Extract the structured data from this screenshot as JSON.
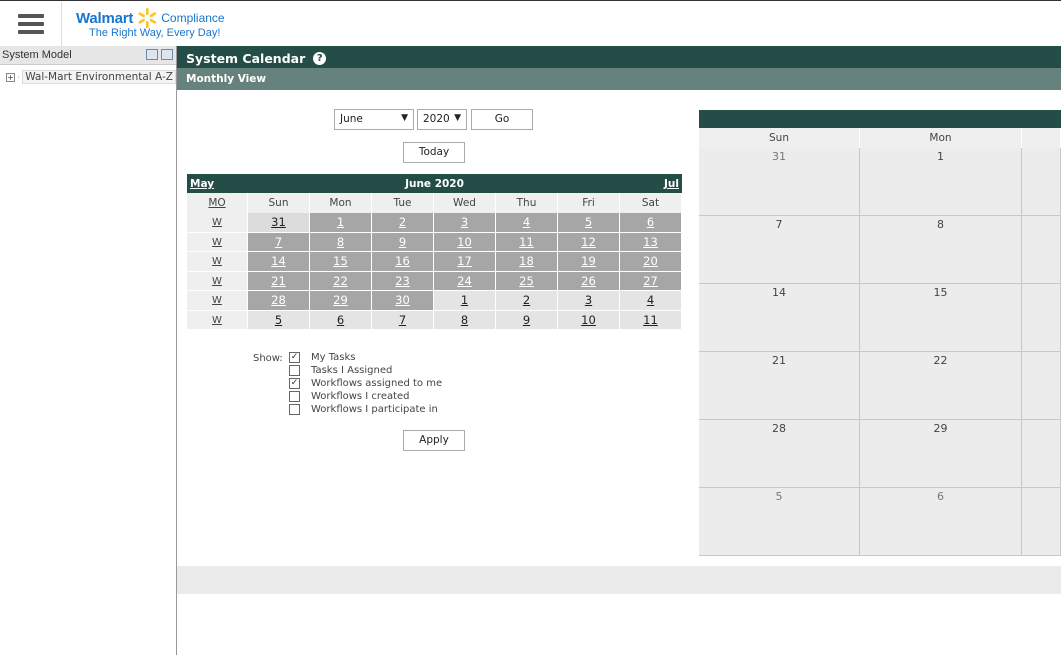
{
  "header": {
    "brand": "Walmart",
    "brand_suffix": "Compliance",
    "tagline": "The Right Way, Every Day!",
    "brand_color": "#1a75cf",
    "spark_color": "#ffc220"
  },
  "sidebar": {
    "title": "System Model",
    "tree": [
      {
        "expander": "+",
        "icon": "home-icon",
        "label": "Wal-Mart Environmental A-Z"
      }
    ]
  },
  "main": {
    "title": "System Calendar",
    "subtitle": "Monthly View",
    "controls": {
      "month": "June",
      "year": "2020",
      "go_label": "Go",
      "today_label": "Today",
      "apply_label": "Apply"
    },
    "mini_calendar": {
      "prev": "May",
      "next": "Jul",
      "month_label": "June 2020",
      "week_header": "MO",
      "days": [
        "Sun",
        "Mon",
        "Tue",
        "Wed",
        "Thu",
        "Fri",
        "Sat"
      ],
      "week_link": "W",
      "weeks": [
        [
          "31",
          "1",
          "2",
          "3",
          "4",
          "5",
          "6"
        ],
        [
          "7",
          "8",
          "9",
          "10",
          "11",
          "12",
          "13"
        ],
        [
          "14",
          "15",
          "16",
          "17",
          "18",
          "19",
          "20"
        ],
        [
          "21",
          "22",
          "23",
          "24",
          "25",
          "26",
          "27"
        ],
        [
          "28",
          "29",
          "30",
          "1",
          "2",
          "3",
          "4"
        ],
        [
          "5",
          "6",
          "7",
          "8",
          "9",
          "10",
          "11"
        ]
      ]
    },
    "show": {
      "label": "Show:",
      "options": [
        {
          "label": "My Tasks",
          "checked": true
        },
        {
          "label": "Tasks I Assigned",
          "checked": false
        },
        {
          "label": "Workflows assigned to me",
          "checked": true
        },
        {
          "label": "Workflows I created",
          "checked": false
        },
        {
          "label": "Workflows I participate in",
          "checked": false
        }
      ]
    },
    "big_calendar": {
      "days": [
        "Sun",
        "Mon",
        ""
      ],
      "rows": [
        [
          "31",
          "1",
          ""
        ],
        [
          "7",
          "8",
          ""
        ],
        [
          "14",
          "15",
          ""
        ],
        [
          "21",
          "22",
          ""
        ],
        [
          "28",
          "29",
          ""
        ],
        [
          "5",
          "6",
          ""
        ]
      ]
    },
    "colors": {
      "title_bar": "#244d47",
      "sub_bar": "#65827d",
      "current_month_cell": "#a6a6a6"
    }
  }
}
